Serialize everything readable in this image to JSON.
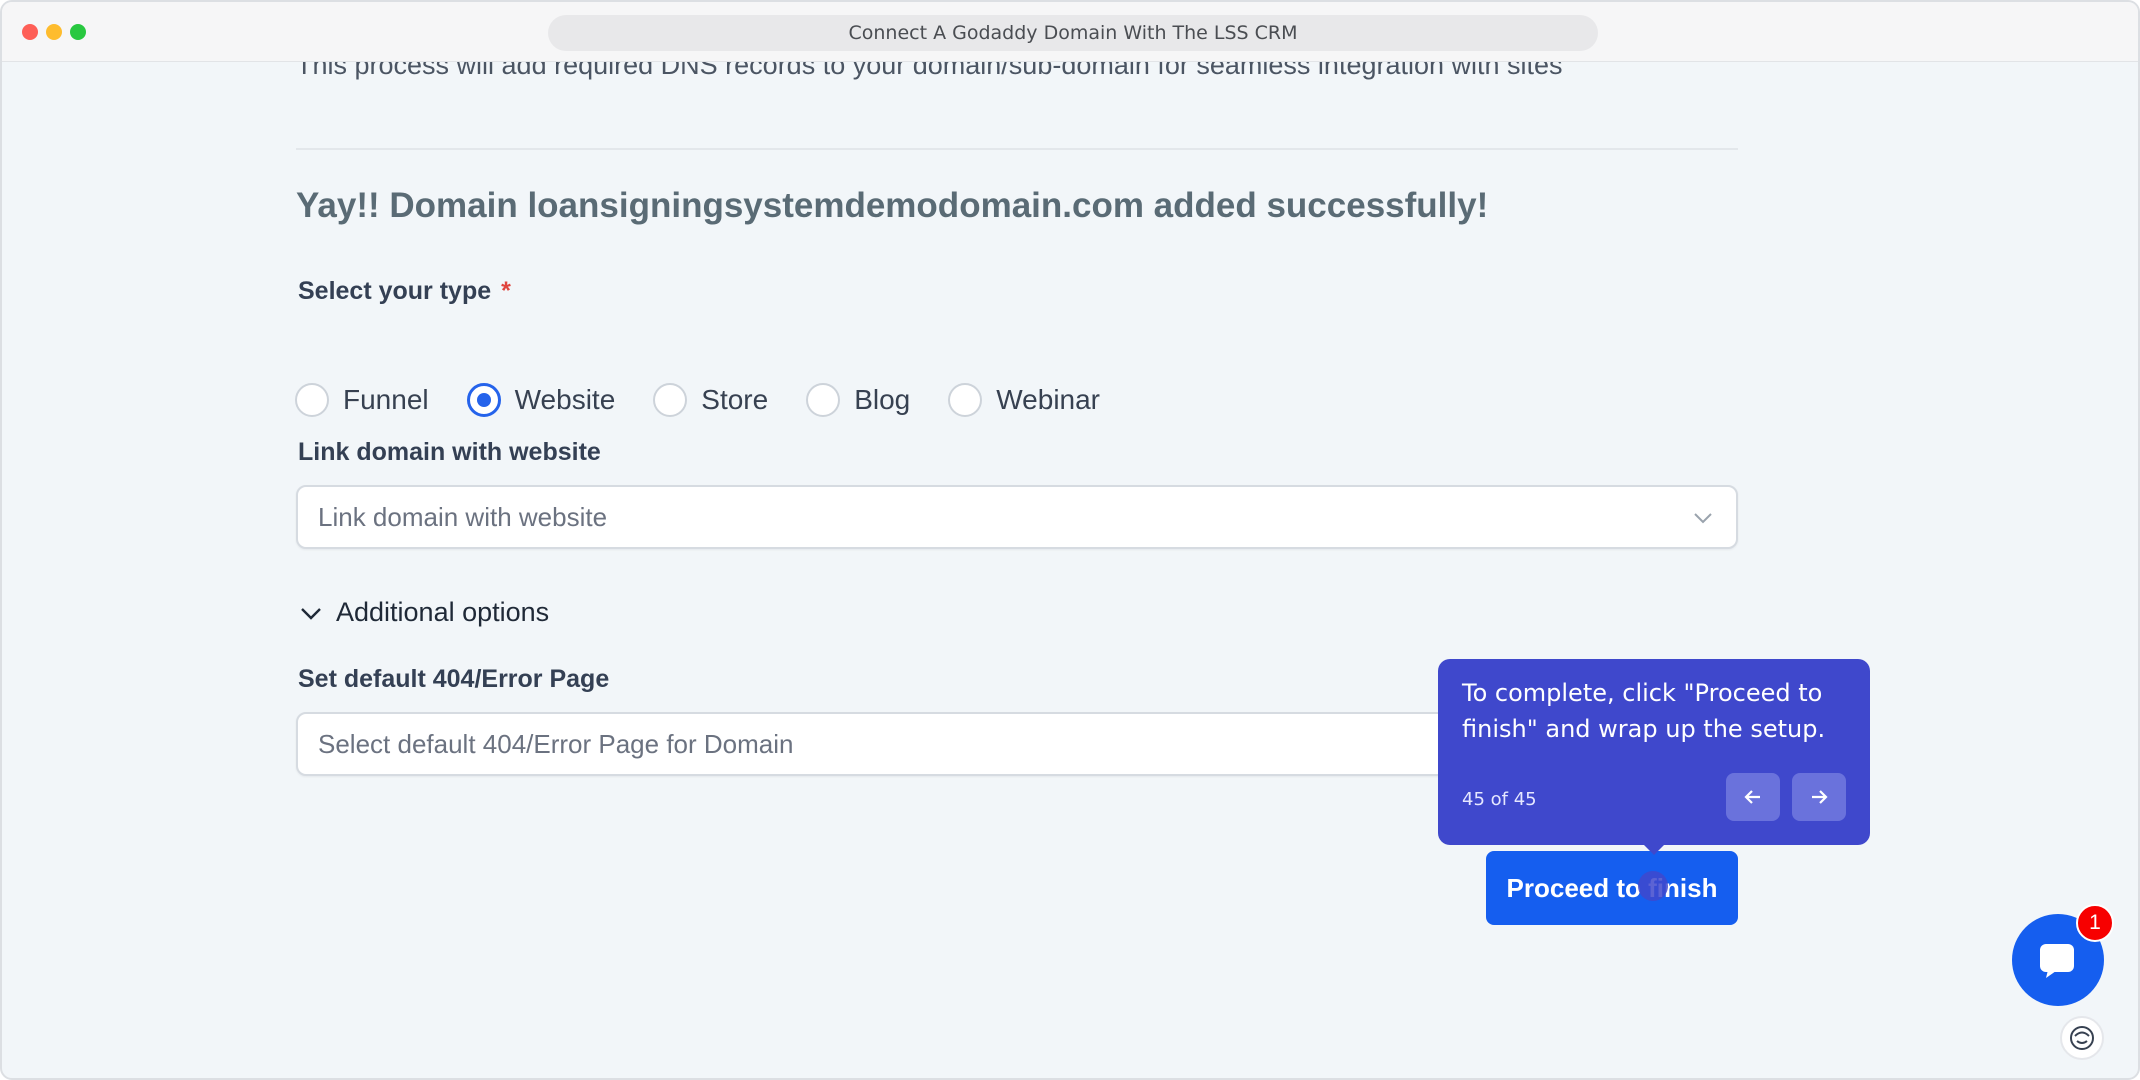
{
  "window": {
    "url_title": "Connect A Godaddy Domain With The LSS CRM"
  },
  "page": {
    "intro": "This process will add required DNS records to your domain/sub-domain for seamless integration with sites",
    "success_message": "Yay!! Domain loansigningsystemdemodomain.com added successfully!",
    "type_label": "Select your type",
    "required_mark": "*",
    "types": [
      {
        "label": "Funnel",
        "checked": false
      },
      {
        "label": "Website",
        "checked": true
      },
      {
        "label": "Store",
        "checked": false
      },
      {
        "label": "Blog",
        "checked": false
      },
      {
        "label": "Webinar",
        "checked": false
      }
    ],
    "link_label": "Link domain with website",
    "link_placeholder": "Link domain with website",
    "additional_options": "Additional options",
    "error_label": "Set default 404/Error Page",
    "error_placeholder": "Select default 404/Error Page for Domain",
    "proceed_label": "Proceed to finish"
  },
  "tooltip": {
    "text": "To complete, click \"Proceed to finish\" and wrap up the setup.",
    "counter": "45 of 45"
  },
  "chat": {
    "badge_count": "1"
  },
  "colors": {
    "primary": "#155eef",
    "tooltip": "#3f48cc",
    "badge": "#f70000"
  }
}
